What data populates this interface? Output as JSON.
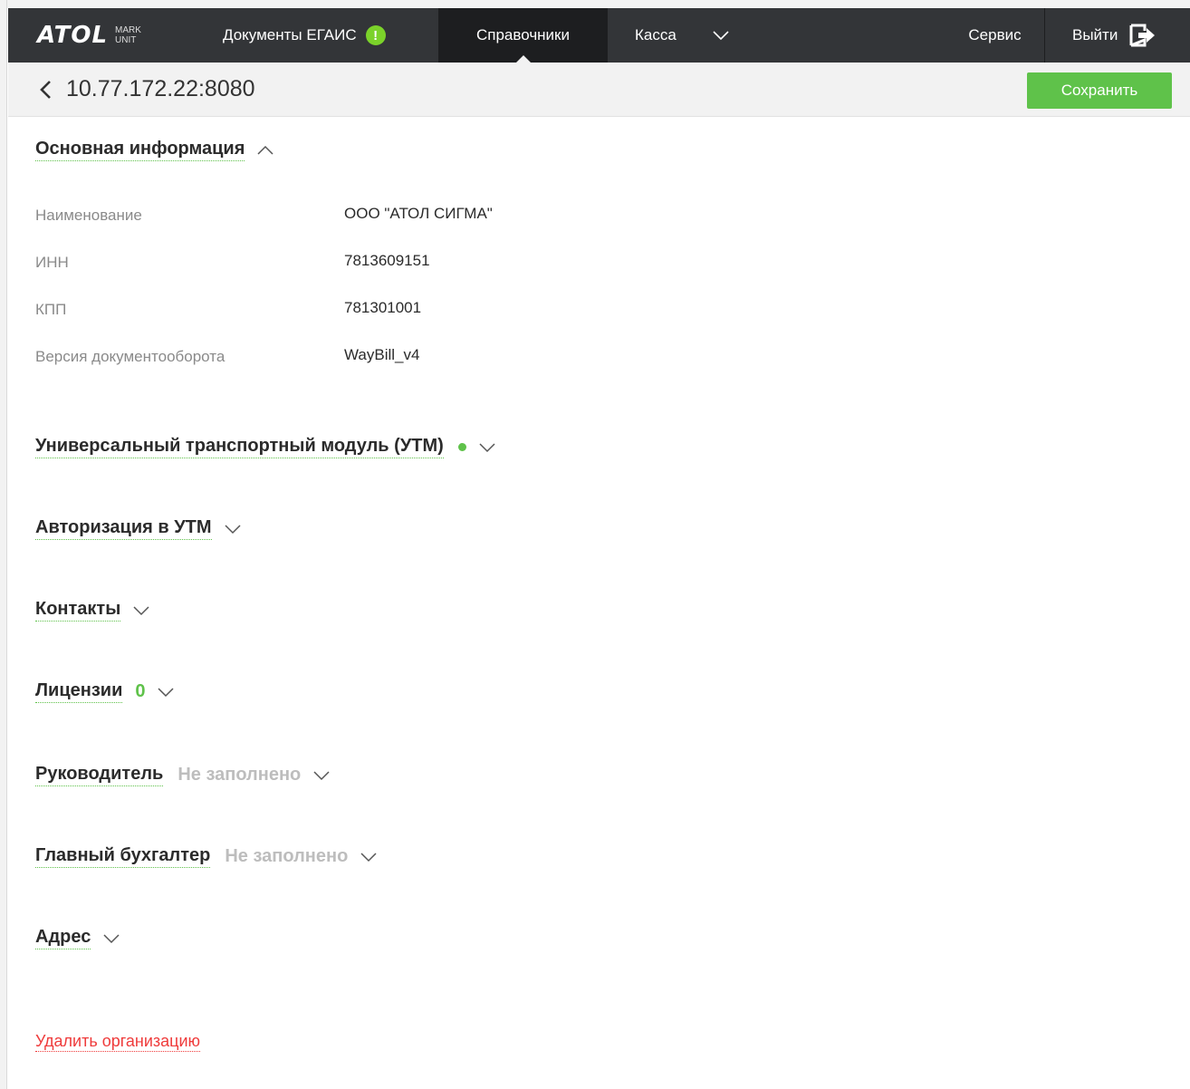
{
  "nav": {
    "logo_main": "ATOL",
    "logo_sub_1": "MARK",
    "logo_sub_2": "UNIT",
    "docs_label": "Документы ЕГАИС",
    "docs_badge": "!",
    "active_label": "Справочники",
    "kassa_label": "Касса",
    "service_label": "Сервис",
    "exit_label": "Выйти"
  },
  "subheader": {
    "title": "10.77.172.22:8080",
    "save_label": "Сохранить"
  },
  "basic_info": {
    "title": "Основная информация",
    "rows": [
      {
        "label": "Наименование",
        "value": "ООО \"АТОЛ СИГМА\""
      },
      {
        "label": "ИНН",
        "value": "7813609151"
      },
      {
        "label": "КПП",
        "value": "781301001"
      },
      {
        "label": "Версия документооборота",
        "value": "WayBill_v4"
      }
    ]
  },
  "sections": {
    "utm": "Универсальный транспортный модуль (УТМ)",
    "auth": "Авторизация в УТМ",
    "contacts": "Контакты",
    "licenses": "Лицензии",
    "licenses_count": "0",
    "director": "Руководитель",
    "director_status": "Не заполнено",
    "accountant": "Главный бухгалтер",
    "accountant_status": "Не заполнено",
    "address": "Адрес"
  },
  "delete_label": "Удалить организацию",
  "colors": {
    "accent_green": "#5fc24a",
    "topbar": "#333538",
    "danger": "#ef3b3b"
  }
}
